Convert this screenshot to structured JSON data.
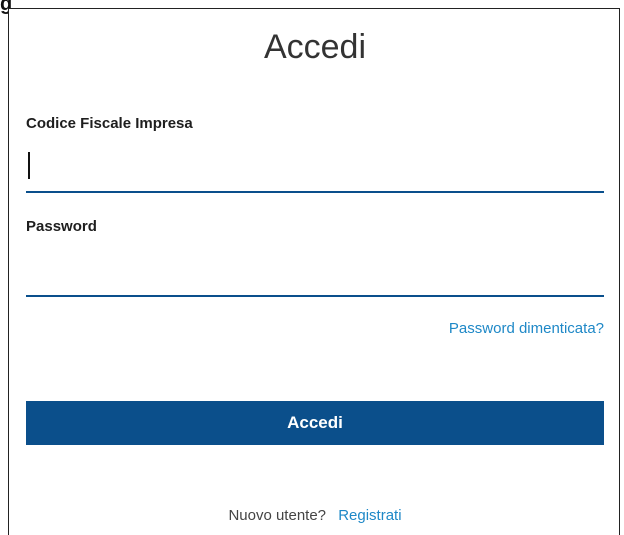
{
  "header": {
    "corner_text": "g"
  },
  "login": {
    "title": "Accedi",
    "fiscal_code_label": "Codice Fiscale Impresa",
    "fiscal_code_value": "",
    "password_label": "Password",
    "password_value": "",
    "forgot_password_link": "Password dimenticata?",
    "submit_label": "Accedi",
    "new_user_prompt": "Nuovo utente?",
    "register_link": "Registrati"
  },
  "colors": {
    "primary": "#0b4f8b",
    "link": "#1e88c7",
    "input_border": "#0a4f8c"
  }
}
